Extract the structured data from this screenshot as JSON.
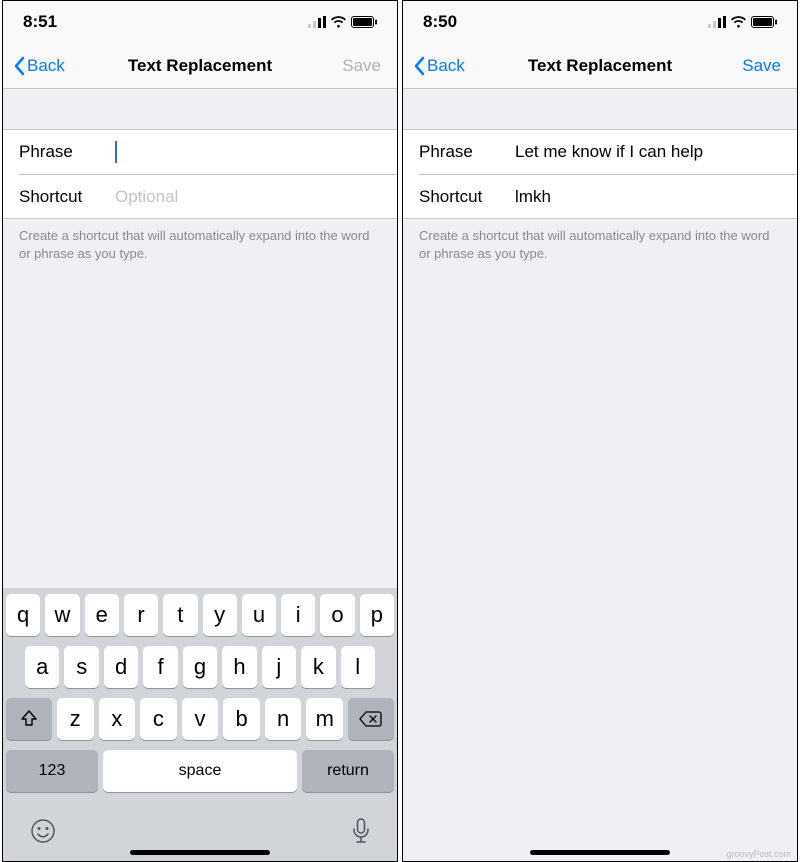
{
  "left": {
    "status": {
      "time": "8:51"
    },
    "nav": {
      "back": "Back",
      "title": "Text Replacement",
      "save": "Save",
      "save_enabled": false
    },
    "form": {
      "phrase_label": "Phrase",
      "phrase_value": "",
      "phrase_placeholder": "",
      "shortcut_label": "Shortcut",
      "shortcut_value": "",
      "shortcut_placeholder": "Optional"
    },
    "help": "Create a shortcut that will automatically expand into the word or phrase as you type.",
    "keyboard": {
      "rows": [
        [
          "q",
          "w",
          "e",
          "r",
          "t",
          "y",
          "u",
          "i",
          "o",
          "p"
        ],
        [
          "a",
          "s",
          "d",
          "f",
          "g",
          "h",
          "j",
          "k",
          "l"
        ],
        [
          "z",
          "x",
          "c",
          "v",
          "b",
          "n",
          "m"
        ]
      ],
      "num": "123",
      "space": "space",
      "return": "return"
    }
  },
  "right": {
    "status": {
      "time": "8:50"
    },
    "nav": {
      "back": "Back",
      "title": "Text Replacement",
      "save": "Save",
      "save_enabled": true
    },
    "form": {
      "phrase_label": "Phrase",
      "phrase_value": "Let me know if I can help",
      "phrase_placeholder": "",
      "shortcut_label": "Shortcut",
      "shortcut_value": "lmkh",
      "shortcut_placeholder": "Optional"
    },
    "help": "Create a shortcut that will automatically expand into the word or phrase as you type."
  },
  "watermark": "groovyPost.com",
  "colors": {
    "ios_blue": "#007aff"
  }
}
